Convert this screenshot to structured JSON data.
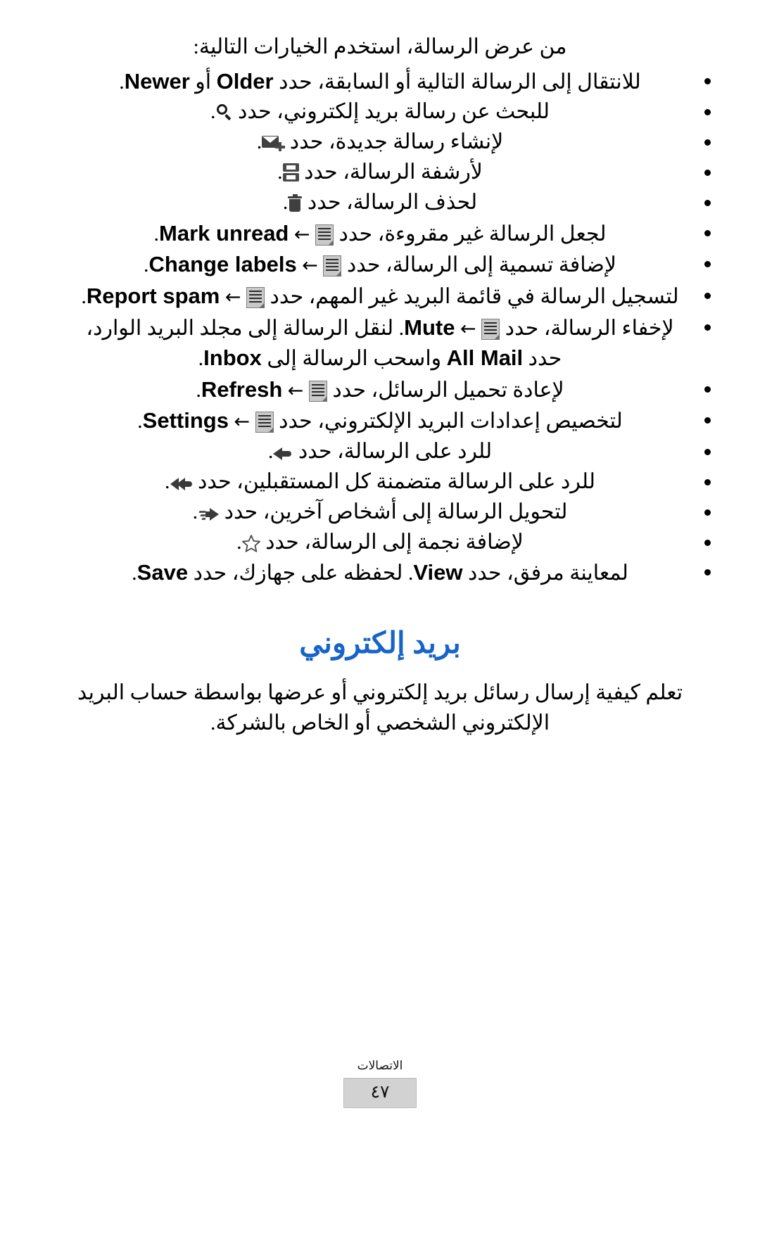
{
  "document": {
    "language": "ar",
    "direction": "rtl",
    "accent_color": "#1664c8"
  },
  "intro": {
    "text": "من عرض الرسالة، استخدم الخيارات التالية:"
  },
  "options": [
    {
      "id": "navigate-older-newer",
      "icon": null,
      "prefix": "للانتقال إلى الرسالة التالية أو السابقة، حدد",
      "en1": "Older",
      "mid": "أو",
      "en2": "Newer",
      "suffix": "."
    },
    {
      "id": "search-email",
      "icon": "search-icon",
      "prefix": "للبحث عن رسالة بريد إلكتروني، حدد",
      "suffix": "."
    },
    {
      "id": "compose-message",
      "icon": "compose-icon",
      "prefix": "لإنشاء رسالة جديدة، حدد",
      "suffix": "."
    },
    {
      "id": "archive-message",
      "icon": "archive-icon",
      "prefix": "لأرشفة الرسالة، حدد",
      "suffix": "."
    },
    {
      "id": "delete-message",
      "icon": "trash-icon",
      "prefix": "لحذف الرسالة، حدد",
      "suffix": "."
    },
    {
      "id": "mark-unread",
      "icon": "menu-icon",
      "prefix": "لجعل الرسالة غير مقروءة، حدد",
      "arrow": "←",
      "en1": "Mark unread",
      "suffix": "."
    },
    {
      "id": "change-labels",
      "icon": "menu-icon",
      "prefix": "لإضافة تسمية إلى الرسالة، حدد",
      "arrow": "←",
      "en1": "Change labels",
      "suffix": "."
    },
    {
      "id": "report-spam",
      "icon": "menu-icon",
      "prefix": "لتسجيل الرسالة في قائمة البريد غير المهم، حدد",
      "arrow": "←",
      "en1": "Report spam",
      "suffix": "."
    },
    {
      "id": "mute-and-move",
      "icon": "menu-icon",
      "prefix": "لإخفاء الرسالة، حدد",
      "arrow": "←",
      "en1": "Mute",
      "mid": ". لنقل الرسالة إلى مجلد البريد الوارد، حدد",
      "en2": "All Mail",
      "mid2": "واسحب الرسالة إلى",
      "en3": "Inbox",
      "suffix": "."
    },
    {
      "id": "refresh-messages",
      "icon": "menu-icon",
      "prefix": "لإعادة تحميل الرسائل، حدد",
      "arrow": "←",
      "en1": "Refresh",
      "suffix": "."
    },
    {
      "id": "email-settings",
      "icon": "menu-icon",
      "prefix": "لتخصيص إعدادات البريد الإلكتروني، حدد",
      "arrow": "←",
      "en1": "Settings",
      "suffix": "."
    },
    {
      "id": "reply-message",
      "icon": "reply-icon",
      "prefix": "للرد على الرسالة، حدد",
      "suffix": "."
    },
    {
      "id": "reply-all",
      "icon": "reply-all-icon",
      "prefix": "للرد على الرسالة متضمنة كل المستقبلين، حدد",
      "suffix": "."
    },
    {
      "id": "forward-message",
      "icon": "forward-icon",
      "prefix": "لتحويل الرسالة إلى أشخاص آخرين، حدد",
      "suffix": "."
    },
    {
      "id": "star-message",
      "icon": "star-icon",
      "prefix": "لإضافة نجمة إلى الرسالة، حدد",
      "suffix": "."
    },
    {
      "id": "view-save-attachment",
      "icon": null,
      "prefix": "لمعاينة مرفق، حدد",
      "en1": "View",
      "mid": ". لحفظه على جهازك، حدد",
      "en2": "Save",
      "suffix": "."
    }
  ],
  "section": {
    "heading": "بريد إلكتروني",
    "paragraph": "تعلم كيفية إرسال رسائل بريد إلكتروني أو عرضها بواسطة حساب البريد الإلكتروني الشخصي أو الخاص بالشركة."
  },
  "footer": {
    "section_label": "الاتصالات",
    "page_number": "٤٧"
  }
}
